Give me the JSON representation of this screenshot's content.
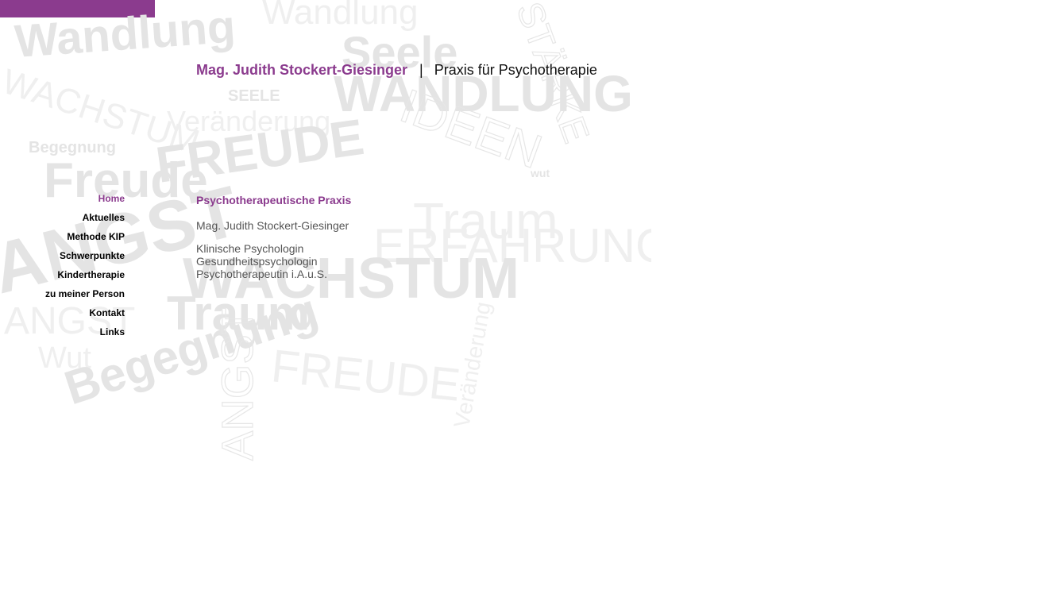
{
  "colors": {
    "brand": "#8b3b8e",
    "nav_text": "#000000",
    "body_text": "#555555",
    "background_words": "#ececec"
  },
  "header": {
    "name": "Mag. Judith Stockert-Giesinger",
    "separator": "|",
    "subtitle": "Praxis für Psychotherapie"
  },
  "nav": {
    "items": [
      {
        "label": "Home",
        "active": true
      },
      {
        "label": "Aktuelles",
        "active": false
      },
      {
        "label": "Methode KIP",
        "active": false
      },
      {
        "label": "Schwerpunkte",
        "active": false
      },
      {
        "label": "Kindertherapie",
        "active": false
      },
      {
        "label": "zu meiner Person",
        "active": false
      },
      {
        "label": "Kontakt",
        "active": false
      },
      {
        "label": "Links",
        "active": false
      }
    ]
  },
  "main": {
    "heading": "Psychotherapeutische Praxis",
    "person_name": "Mag. Judith Stockert-Giesinger",
    "titles": [
      "Klinische Psychologin",
      "Gesundheitspsychologin",
      "Psychotherapeutin i.A.u.S."
    ]
  }
}
